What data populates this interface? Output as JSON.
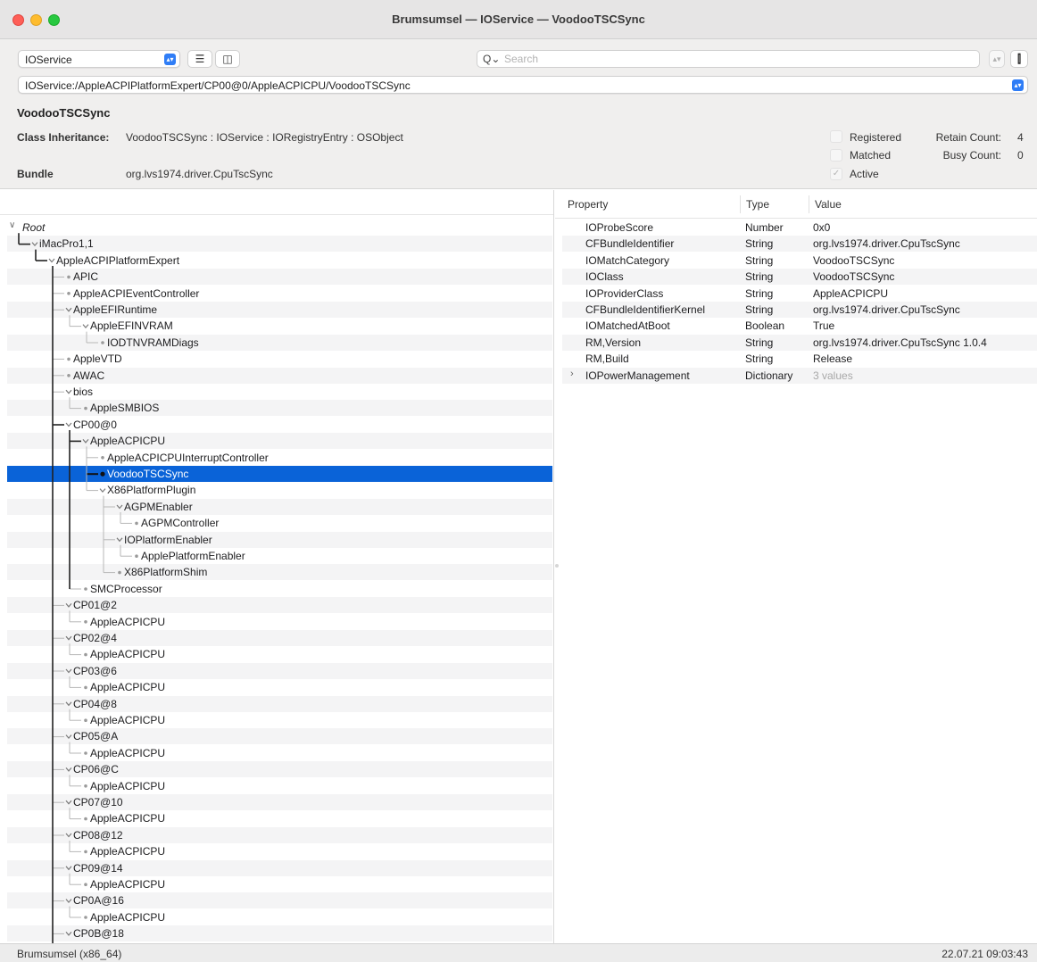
{
  "window": {
    "title": "Brumsumsel — IOService — VoodooTSCSync"
  },
  "toolbar": {
    "service_plane": "IOService",
    "list_view_icon": "list-icon",
    "column_view_icon": "columns-icon",
    "search_placeholder": "Search",
    "search_glyph": "Q⌄",
    "path": "IOService:/AppleACPIPlatformExpert/CP00@0/AppleACPICPU/VoodooTSCSync"
  },
  "info": {
    "name": "VoodooTSCSync",
    "inheritance_label": "Class Inheritance:",
    "inheritance": "VoodooTSCSync : IOService : IORegistryEntry : OSObject",
    "bundle_label": "Bundle",
    "bundle": "org.lvs1974.driver.CpuTscSync",
    "registered_label": "Registered",
    "matched_label": "Matched",
    "active_label": "Active",
    "retain_label": "Retain Count:",
    "retain_count": "4",
    "busy_label": "Busy Count:",
    "busy_count": "0"
  },
  "property_table": {
    "headers": [
      "Property",
      "Type",
      "Value"
    ],
    "rows": [
      {
        "property": "IOProbeScore",
        "type": "Number",
        "value": "0x0"
      },
      {
        "property": "CFBundleIdentifier",
        "type": "String",
        "value": "org.lvs1974.driver.CpuTscSync"
      },
      {
        "property": "IOMatchCategory",
        "type": "String",
        "value": "VoodooTSCSync"
      },
      {
        "property": "IOClass",
        "type": "String",
        "value": "VoodooTSCSync"
      },
      {
        "property": "IOProviderClass",
        "type": "String",
        "value": "AppleACPICPU"
      },
      {
        "property": "CFBundleIdentifierKernel",
        "type": "String",
        "value": "org.lvs1974.driver.CpuTscSync"
      },
      {
        "property": "IOMatchedAtBoot",
        "type": "Boolean",
        "value": "True"
      },
      {
        "property": "RM,Version",
        "type": "String",
        "value": "org.lvs1974.driver.CpuTscSync 1.0.4"
      },
      {
        "property": "RM,Build",
        "type": "String",
        "value": "Release"
      },
      {
        "property": "IOPowerManagement",
        "type": "Dictionary",
        "value": "3 values",
        "expandable": true
      }
    ]
  },
  "tree": [
    {
      "label": "Root",
      "depth": 0,
      "expanded": true,
      "italic": true
    },
    {
      "label": "iMacPro1,1",
      "depth": 1,
      "expanded": true
    },
    {
      "label": "AppleACPIPlatformExpert",
      "depth": 2,
      "expanded": true
    },
    {
      "label": "APIC",
      "depth": 3
    },
    {
      "label": "AppleACPIEventController",
      "depth": 3
    },
    {
      "label": "AppleEFIRuntime",
      "depth": 3,
      "expanded": true
    },
    {
      "label": "AppleEFINVRAM",
      "depth": 4,
      "expanded": true
    },
    {
      "label": "IODTNVRAMDiags",
      "depth": 5
    },
    {
      "label": "AppleVTD",
      "depth": 3
    },
    {
      "label": "AWAC",
      "depth": 3
    },
    {
      "label": "bios",
      "depth": 3,
      "expanded": true
    },
    {
      "label": "AppleSMBIOS",
      "depth": 4
    },
    {
      "label": "CP00@0",
      "depth": 3,
      "expanded": true
    },
    {
      "label": "AppleACPICPU",
      "depth": 4,
      "expanded": true
    },
    {
      "label": "AppleACPICPUInterruptController",
      "depth": 5
    },
    {
      "label": "VoodooTSCSync",
      "depth": 5,
      "selected": true
    },
    {
      "label": "X86PlatformPlugin",
      "depth": 5,
      "expanded": true
    },
    {
      "label": "AGPMEnabler",
      "depth": 6,
      "expanded": true
    },
    {
      "label": "AGPMController",
      "depth": 7
    },
    {
      "label": "IOPlatformEnabler",
      "depth": 6,
      "expanded": true
    },
    {
      "label": "ApplePlatformEnabler",
      "depth": 7
    },
    {
      "label": "X86PlatformShim",
      "depth": 6
    },
    {
      "label": "SMCProcessor",
      "depth": 4
    },
    {
      "label": "CP01@2",
      "depth": 3,
      "expanded": true
    },
    {
      "label": "AppleACPICPU",
      "depth": 4
    },
    {
      "label": "CP02@4",
      "depth": 3,
      "expanded": true
    },
    {
      "label": "AppleACPICPU",
      "depth": 4
    },
    {
      "label": "CP03@6",
      "depth": 3,
      "expanded": true
    },
    {
      "label": "AppleACPICPU",
      "depth": 4
    },
    {
      "label": "CP04@8",
      "depth": 3,
      "expanded": true
    },
    {
      "label": "AppleACPICPU",
      "depth": 4
    },
    {
      "label": "CP05@A",
      "depth": 3,
      "expanded": true
    },
    {
      "label": "AppleACPICPU",
      "depth": 4
    },
    {
      "label": "CP06@C",
      "depth": 3,
      "expanded": true
    },
    {
      "label": "AppleACPICPU",
      "depth": 4
    },
    {
      "label": "CP07@10",
      "depth": 3,
      "expanded": true
    },
    {
      "label": "AppleACPICPU",
      "depth": 4
    },
    {
      "label": "CP08@12",
      "depth": 3,
      "expanded": true
    },
    {
      "label": "AppleACPICPU",
      "depth": 4
    },
    {
      "label": "CP09@14",
      "depth": 3,
      "expanded": true
    },
    {
      "label": "AppleACPICPU",
      "depth": 4
    },
    {
      "label": "CP0A@16",
      "depth": 3,
      "expanded": true
    },
    {
      "label": "AppleACPICPU",
      "depth": 4
    },
    {
      "label": "CP0B@18",
      "depth": 3,
      "expanded": true
    }
  ],
  "status": {
    "left": "Brumsumsel (x86_64)",
    "right": "22.07.21 09:03:43"
  },
  "colors": {
    "selection": "#0a63d8",
    "accent": "#2f7df6",
    "zebra": "#f4f4f5"
  }
}
